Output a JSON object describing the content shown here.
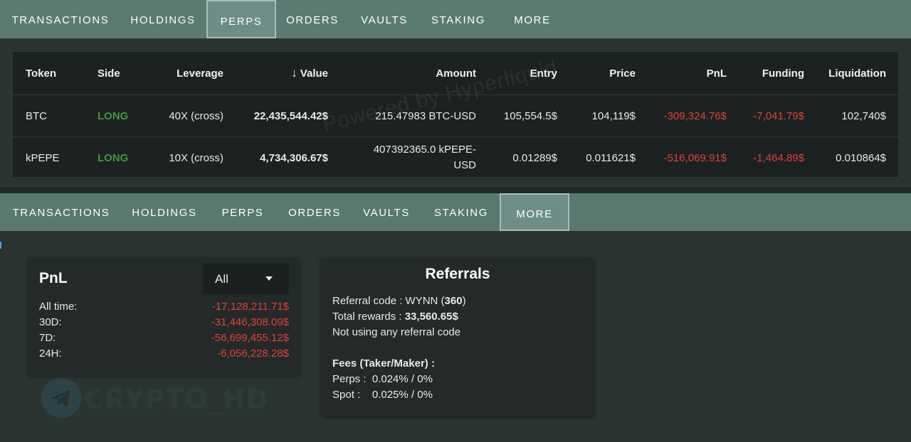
{
  "top_tabs": [
    "TRANSACTIONS",
    "HOLDINGS",
    "PERPS",
    "ORDERS",
    "VAULTS",
    "STAKING",
    "MORE"
  ],
  "bottom_tabs": [
    "TRANSACTIONS",
    "HOLDINGS",
    "PERPS",
    "ORDERS",
    "VAULTS",
    "STAKING",
    "MORE"
  ],
  "top_active_tab": "PERPS",
  "bottom_active_tab": "MORE",
  "perps_table": {
    "headers": [
      "Token",
      "Side",
      "Leverage",
      "Value",
      "Amount",
      "Entry",
      "Price",
      "PnL",
      "Funding",
      "Liquidation"
    ],
    "sort_arrow": "↓",
    "rows": [
      {
        "token": "BTC",
        "side": "LONG",
        "leverage": "40X (cross)",
        "value": "22,435,544.42$",
        "amount": "215.47983 BTC-USD",
        "entry": "105,554.5$",
        "price": "104,119$",
        "pnl": "-309,324.76$",
        "funding": "-7,041.79$",
        "liquidation": "102,740$"
      },
      {
        "token": "kPEPE",
        "side": "LONG",
        "leverage": "10X (cross)",
        "value": "4,734,306.67$",
        "amount": "407392365.0 kPEPE-USD",
        "entry": "0.01289$",
        "price": "0.011621$",
        "pnl": "-516,069.91$",
        "funding": "-1,464.89$",
        "liquidation": "0.010864$"
      }
    ],
    "watermark": "Powered by Hyperliquid"
  },
  "pnl": {
    "title": "PnL",
    "filter_value": "All",
    "rows": [
      {
        "label": "All time:",
        "value": "-17,128,211.71$"
      },
      {
        "label": "30D:",
        "value": "-31,446,308.09$"
      },
      {
        "label": "7D:",
        "value": "-56,699,455.12$"
      },
      {
        "label": "24H:",
        "value": "-6,056,228.28$"
      }
    ]
  },
  "referrals": {
    "title": "Referrals",
    "code_label": "Referral code : WYNN (",
    "code_count": "360",
    "code_close": ")",
    "rewards_label": "Total rewards : ",
    "rewards_value": "33,560.65$",
    "not_using": "Not using any referral code",
    "fees_title": "Fees (Taker/Maker) :",
    "perps_fee": "Perps :  0.024% / 0%",
    "spot_fee": "Spot :    0.025% / 0%"
  },
  "overlay_logo": "CRYPTO_HD",
  "colors": {
    "negative": "#e0403a",
    "long": "#3e9a3b",
    "tabbar": "#5b7a72"
  }
}
